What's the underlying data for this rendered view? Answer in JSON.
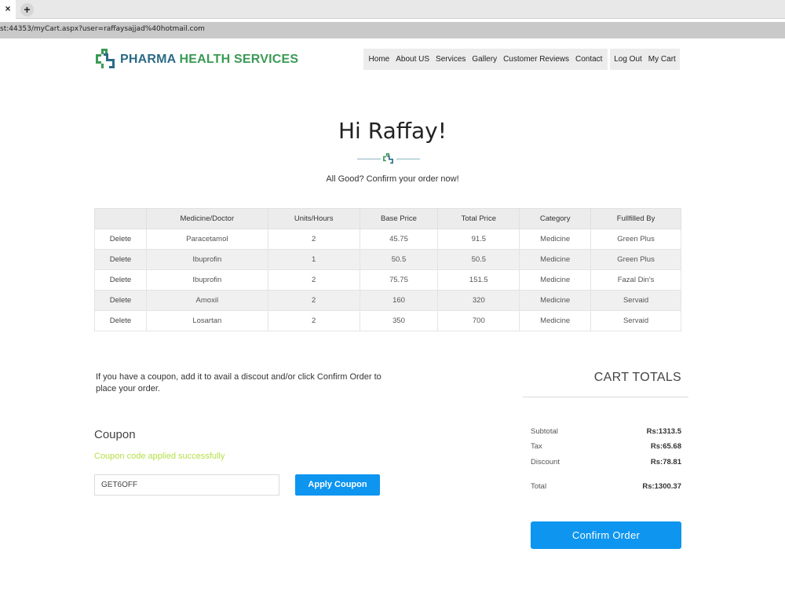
{
  "browser": {
    "tab_close": "×",
    "new_tab": "+",
    "url": "st:44353/myCart.aspx?user=raffaysajjad%40hotmail.com"
  },
  "brand": {
    "word1": "PHARMA ",
    "word2": "HEALTH SERVICES"
  },
  "nav": {
    "primary": [
      "Home",
      "About US",
      "Services",
      "Gallery",
      "Customer Reviews",
      "Contact"
    ],
    "secondary": [
      "Log Out",
      "My Cart"
    ]
  },
  "hero": {
    "title": "Hi Raffay!",
    "subtitle": "All Good? Confirm your order now!"
  },
  "cart_table": {
    "headers": [
      "",
      "Medicine/Doctor",
      "Units/Hours",
      "Base Price",
      "Total Price",
      "Category",
      "Fullfilled By"
    ],
    "rows": [
      [
        "Delete",
        "Paracetamol",
        "2",
        "45.75",
        "91.5",
        "Medicine",
        "Green Plus"
      ],
      [
        "Delete",
        "Ibuprofin",
        "1",
        "50.5",
        "50.5",
        "Medicine",
        "Green Plus"
      ],
      [
        "Delete",
        "Ibuprofin",
        "2",
        "75.75",
        "151.5",
        "Medicine",
        "Fazal Din's"
      ],
      [
        "Delete",
        "Amoxil",
        "2",
        "160",
        "320",
        "Medicine",
        "Servaid"
      ],
      [
        "Delete",
        "Losartan",
        "2",
        "350",
        "700",
        "Medicine",
        "Servaid"
      ]
    ]
  },
  "coupon": {
    "note": "If you have a coupon, add it to avail a discout and/or click Confirm Order to place your order.",
    "heading": "Coupon",
    "success_message": "Coupon code applied successfully",
    "input_value": "GET6OFF",
    "apply_label": "Apply Coupon"
  },
  "totals": {
    "title": "CART TOTALS",
    "rows": [
      {
        "label": "Subtotal",
        "value": "Rs:1313.5"
      },
      {
        "label": "Tax",
        "value": "Rs:65.68"
      },
      {
        "label": "Discount",
        "value": "Rs:78.81"
      },
      {
        "label": "Total",
        "value": "Rs:1300.37"
      }
    ],
    "confirm_label": "Confirm Order"
  },
  "colors": {
    "accent": "#0d95f0",
    "brand_blue": "#2c6b86",
    "brand_green": "#3a9a55",
    "success": "#b6e04a"
  }
}
